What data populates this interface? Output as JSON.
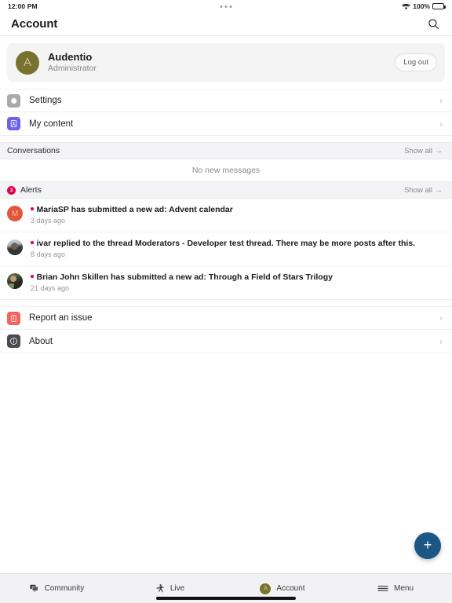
{
  "status_bar": {
    "time": "12:00 PM",
    "battery_percent": "100%",
    "wifi_icon": "wifi-icon",
    "battery_icon": "battery-full-icon",
    "dots_icon": "more-dots-indicator"
  },
  "header": {
    "title": "Account",
    "search_icon": "search-icon"
  },
  "profile": {
    "avatar_letter": "A",
    "avatar_color": "#77722f",
    "name": "Audentio",
    "role": "Administrator",
    "logout_label": "Log out"
  },
  "menu_rows": [
    {
      "label": "Settings",
      "icon": "gear-icon",
      "icon_color": "#a8a8ad",
      "chevron": "›"
    },
    {
      "label": "My content",
      "icon": "contact-card-icon",
      "icon_color": "#6b63e8",
      "chevron": "›"
    }
  ],
  "conversations": {
    "title": "Conversations",
    "show_all": "Show all",
    "show_all_arrow": "→",
    "empty_message": "No new messages"
  },
  "alerts": {
    "title": "Alerts",
    "badge_count": "3",
    "badge_color": "#e6004c",
    "show_all": "Show all",
    "show_all_arrow": "→",
    "items": [
      {
        "avatar_type": "letter",
        "avatar_letter": "M",
        "avatar_color": "#e2563a",
        "text": "MariaSP has submitted a new ad: Advent calendar",
        "time": "3 days ago",
        "unread": true
      },
      {
        "avatar_type": "photo",
        "avatar_letter": "",
        "avatar_color": "#3a3a3c",
        "text": "ivar replied to the thread Moderators - Developer test thread. There may be more posts after this.",
        "time": "8 days ago",
        "unread": true
      },
      {
        "avatar_type": "photo",
        "avatar_letter": "",
        "avatar_color": "#4c5733",
        "text": "Brian John Skillen has submitted a new ad: Through a Field of Stars Trilogy",
        "time": "21 days ago",
        "unread": true
      }
    ]
  },
  "footer_rows": [
    {
      "label": "Report an issue",
      "icon": "report-issue-icon",
      "icon_color": "#f4635e",
      "chevron": "›"
    },
    {
      "label": "About",
      "icon": "info-icon",
      "icon_color": "#4b4b50",
      "chevron": "›"
    }
  ],
  "fab": {
    "icon": "plus-icon",
    "label": "+",
    "color": "#1b5684"
  },
  "bottom_nav": {
    "items": [
      {
        "label": "Community",
        "icon": "community-chat-icon",
        "active": false
      },
      {
        "label": "Live",
        "icon": "live-running-person-icon",
        "active": true
      },
      {
        "label": "Account",
        "icon": "account-avatar-icon",
        "avatar_letter": "A",
        "active": false
      },
      {
        "label": "Menu",
        "icon": "hamburger-menu-icon",
        "active": false
      }
    ]
  }
}
